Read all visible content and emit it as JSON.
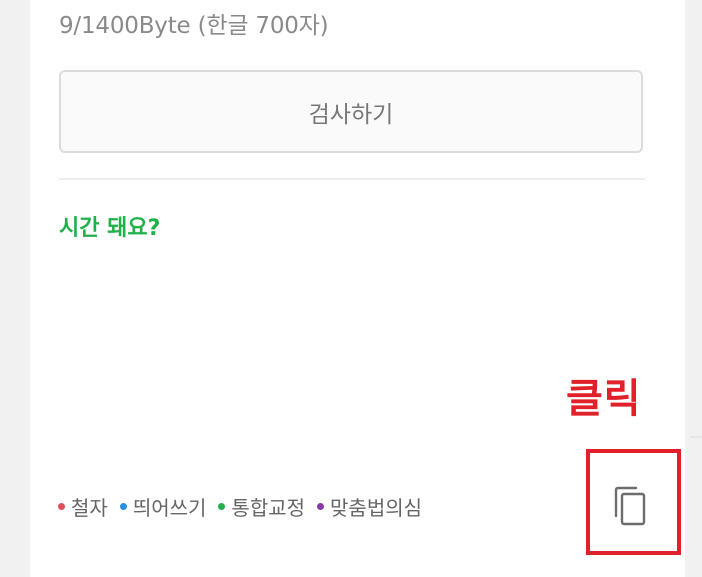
{
  "editor": {
    "byte_count": "9/1400Byte (한글 700자)",
    "check_button_label": "검사하기"
  },
  "result": {
    "text": "시간 돼요?",
    "color": "#22b04a"
  },
  "annotation": {
    "label": "클릭",
    "color": "#e0202a"
  },
  "legend": {
    "items": [
      {
        "label": "철자",
        "color": "#e0505a"
      },
      {
        "label": "띄어쓰기",
        "color": "#2a8ee0"
      },
      {
        "label": "통합교정",
        "color": "#22b04a"
      },
      {
        "label": "맞춤법의심",
        "color": "#8a3aa8"
      }
    ]
  },
  "copy_button": {
    "icon": "copy-icon"
  }
}
